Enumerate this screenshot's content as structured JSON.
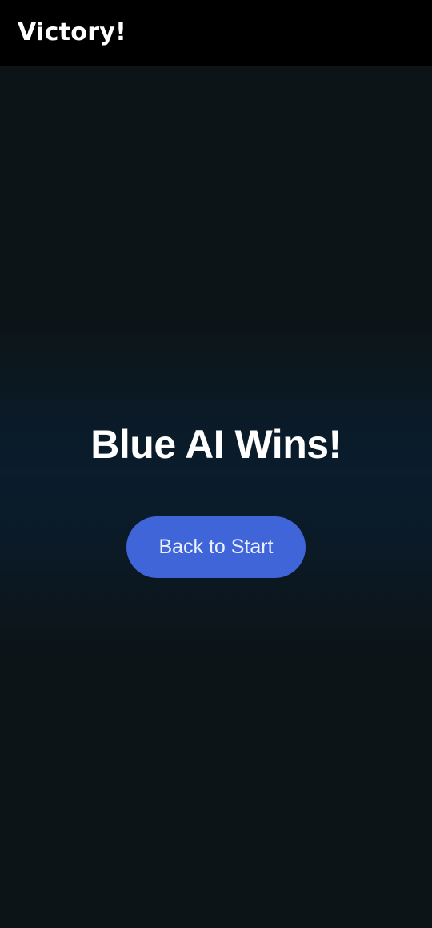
{
  "app_bar": {
    "title": "Victory!"
  },
  "main": {
    "result_text": "Blue AI Wins!",
    "back_button_label": "Back to Start"
  },
  "colors": {
    "app_bar_bg": "#000000",
    "page_bg": "#0c1418",
    "button_bg": "#3f65d8",
    "text": "#ffffff"
  }
}
